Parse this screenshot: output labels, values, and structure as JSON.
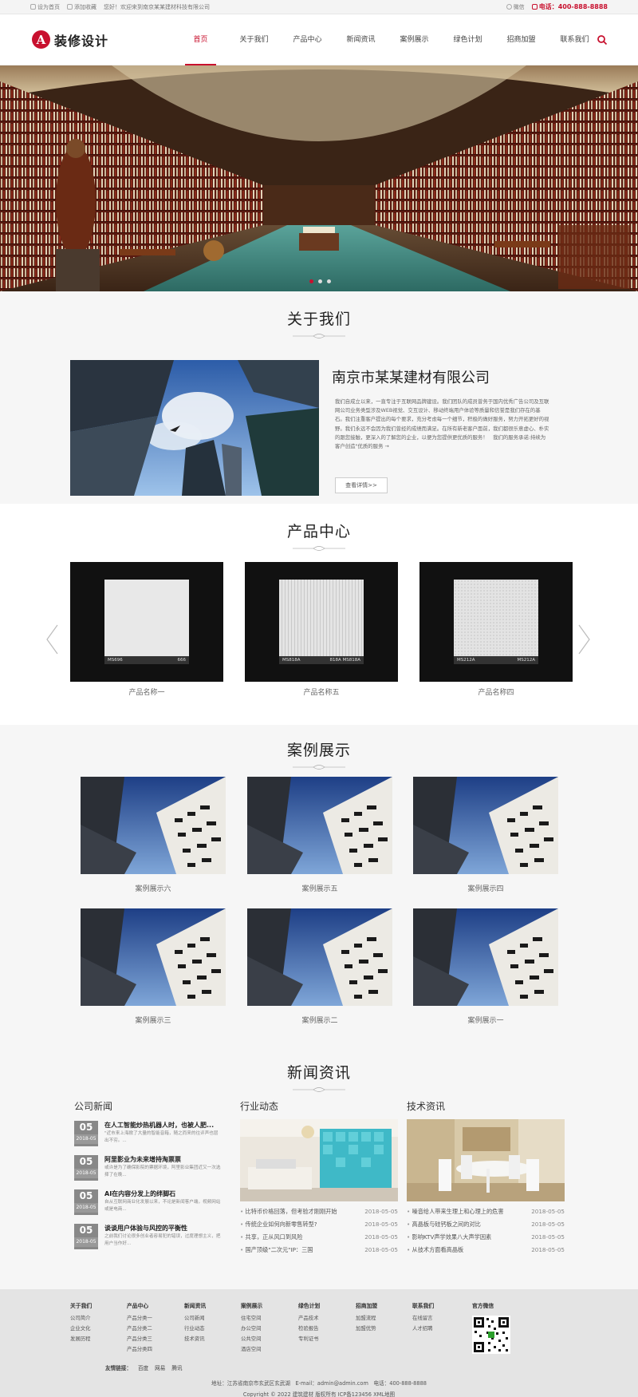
{
  "topbar": {
    "set_home": "设为首页",
    "add_fav": "添加收藏",
    "welcome": "您好！欢迎来到南京某某建材科技有限公司",
    "wechat": "微信",
    "phone_label": "电话：",
    "phone": "400-888-8888"
  },
  "header": {
    "logo_mark": "A",
    "logo_text": "装修设计",
    "nav": [
      {
        "label": "首页",
        "active": true
      },
      {
        "label": "关于我们"
      },
      {
        "label": "产品中心"
      },
      {
        "label": "新闻资讯"
      },
      {
        "label": "案例展示"
      },
      {
        "label": "绿色计划"
      },
      {
        "label": "招商加盟"
      },
      {
        "label": "联系我们"
      }
    ],
    "search_icon": "search-icon"
  },
  "banner": {
    "slides": 3,
    "current": 1
  },
  "about": {
    "title": "关于我们",
    "company": "南京市某某建材有限公司",
    "text": "我们自成立以来，一直专注于互联网品牌建设。我们团队的成员曾务于国内优秀广告公司及互联网公司业务类型涉及WEB视觉、交互设计、移动终端用户体验等质量和信誉是我们存在的基石。我们注重客户提出的每个要求，充分考虑每一个细节，积极的做好服务，努力开拓更好的视野。我们永远不会因为我们曾经的成绩而满足。在所有新老客户面前，我们都很乐意虚心、朴实的跟您接触，更深入的了解您的企业，以便为您提供更优质的服务！　我们的服务承诺:持续为客户创造\"优质的服务 →",
    "more": "查看详情>>"
  },
  "products": {
    "title": "产品中心",
    "items": [
      {
        "name": "产品名称一",
        "code_l": "MS696",
        "code_r": "666",
        "style": "t1"
      },
      {
        "name": "产品名称五",
        "code_l": "MS818A",
        "code_r": "818A MS818A",
        "style": "t2"
      },
      {
        "name": "产品名称四",
        "code_l": "MS212A",
        "code_r": "MS212A",
        "style": "t3"
      }
    ]
  },
  "cases": {
    "title": "案例展示",
    "items": [
      "案例展示六",
      "案例展示五",
      "案例展示四",
      "案例展示三",
      "案例展示二",
      "案例展示一"
    ]
  },
  "news": {
    "title": "新闻资讯",
    "col1_title": "公司新闻",
    "col2_title": "行业动态",
    "col3_title": "技术资讯",
    "company": [
      {
        "day": "05",
        "ym": "2018-05",
        "title": "在人工智能炒热机器人时，也被人肥...",
        "summary": "\"近市来上海掀了大量的智能音箱，随之而来的往评声也层出不穷。..."
      },
      {
        "day": "05",
        "ym": "2018-05",
        "title": "阿里影业为未来增持淘票票",
        "summary": "或许是为了确保影院的票据环境，阿里影业集团近又一次选择了在晚..."
      },
      {
        "day": "05",
        "ym": "2018-05",
        "title": "AI在内容分发上的绊脚石",
        "summary": "自从互联网商业化发展以来，不论是新闻客户端，视频网站或是电商..."
      },
      {
        "day": "05",
        "ym": "2018-05",
        "title": "谈谈用户体验与风控的平衡性",
        "summary": "之前我们讨论很多创业者容易犯的错误，过度理想主义，把用户当作好..."
      }
    ],
    "industry": [
      {
        "title": "比特币价格回落，但考验才刚刚开始",
        "date": "2018-05-05"
      },
      {
        "title": "传统企业如何向新零售转型?",
        "date": "2018-05-05"
      },
      {
        "title": "共享，正从风口到风险",
        "date": "2018-05-05"
      },
      {
        "title": "国产顶级\"二次元\"IP：三国",
        "date": "2018-05-05"
      }
    ],
    "tech": [
      {
        "title": "噪音给人带来生理上和心理上的危害",
        "date": "2018-05-05"
      },
      {
        "title": "高晶板与硅钙板之间的对比",
        "date": "2018-05-05"
      },
      {
        "title": "影响KTV声学效果八大声学因素",
        "date": "2018-05-05"
      },
      {
        "title": "从技术方面看高晶板",
        "date": "2018-05-05"
      }
    ]
  },
  "footer": {
    "columns": [
      {
        "title": "关于我们",
        "items": [
          "公司简介",
          "企业文化",
          "发展历程"
        ]
      },
      {
        "title": "产品中心",
        "items": [
          "产品分类一",
          "产品分类二",
          "产品分类三",
          "产品分类四"
        ]
      },
      {
        "title": "新闻资讯",
        "items": [
          "公司新闻",
          "行业动态",
          "技术资讯"
        ]
      },
      {
        "title": "案例展示",
        "items": [
          "住宅空间",
          "办公空间",
          "公共空间",
          "酒店空间"
        ]
      },
      {
        "title": "绿色计划",
        "items": [
          "产品技术",
          "检验报告",
          "专利证书"
        ]
      },
      {
        "title": "招商加盟",
        "items": [
          "加盟流程",
          "加盟优势"
        ]
      },
      {
        "title": "联系我们",
        "items": [
          "在线留言",
          "人才招聘"
        ]
      }
    ],
    "wechat_title": "官方微信",
    "links_label": "友情链接：",
    "links": [
      "百度",
      "网易",
      "腾讯"
    ],
    "address": "地址：江苏省南京市玄武区玄武湖　E-mail：admin@admin.com　电话：400-888-8888",
    "copyright": "Copyright © 2022 建筑建材 版权所有 ICP备123456 XML地图"
  }
}
